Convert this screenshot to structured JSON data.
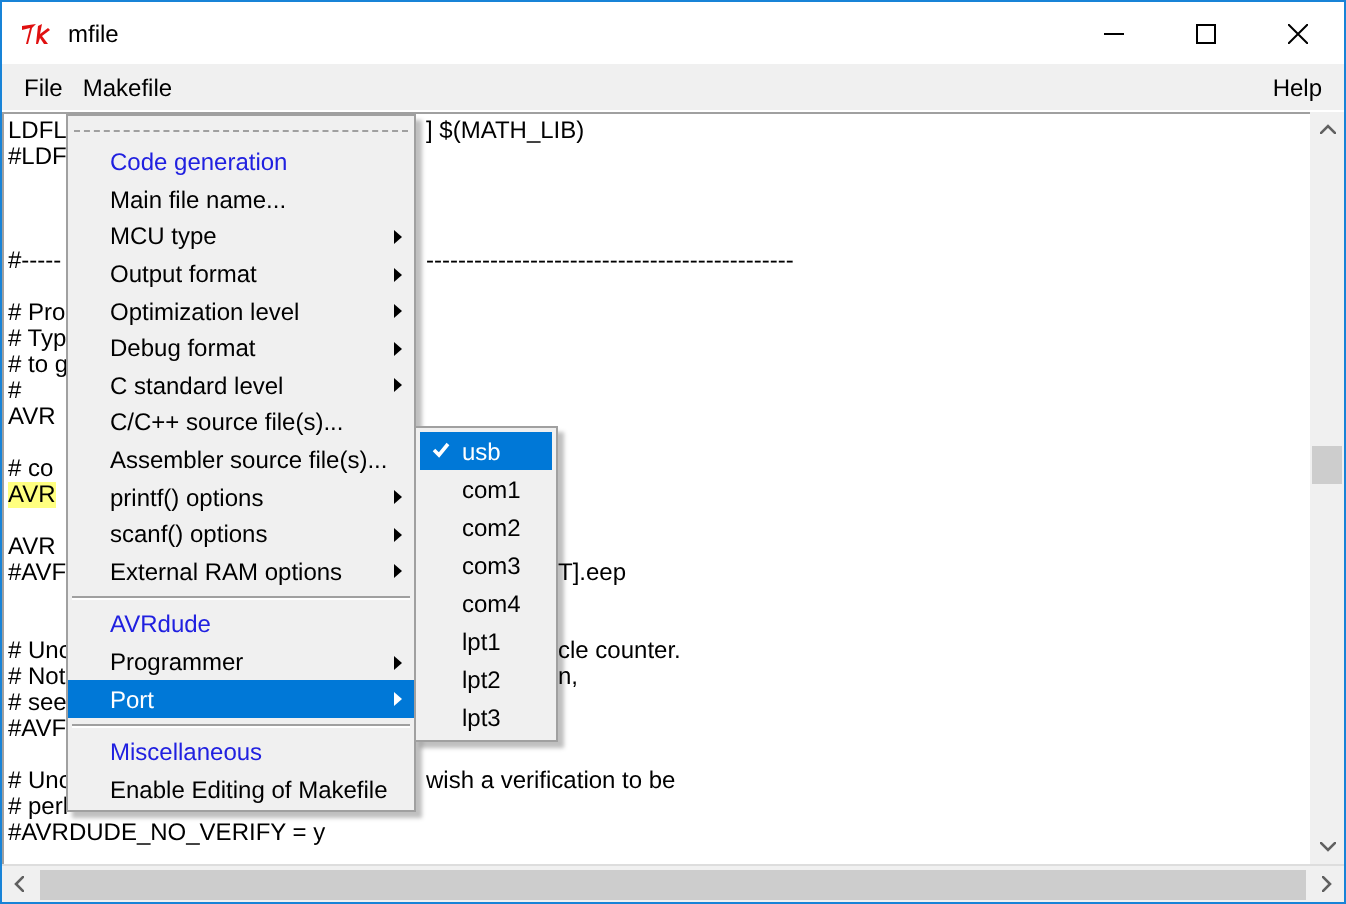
{
  "window": {
    "title": "mfile"
  },
  "menubar": {
    "items": [
      {
        "label": "File"
      },
      {
        "label": "Makefile"
      }
    ],
    "help": "Help"
  },
  "editor": {
    "lines": [
      {
        "kind": "text",
        "text": "LDFL",
        "tail": "] $(MATH_LIB)",
        "highlighted": false
      },
      {
        "kind": "text",
        "text": "#LDF",
        "highlighted": false
      },
      {
        "kind": "blank"
      },
      {
        "kind": "blank"
      },
      {
        "kind": "blank"
      },
      {
        "kind": "text",
        "text": "#-----",
        "tail": "----------------------------------------------",
        "highlighted": false
      },
      {
        "kind": "blank"
      },
      {
        "kind": "text",
        "text": "# Pro",
        "highlighted": false
      },
      {
        "kind": "text",
        "text": "# Typ",
        "highlighted": false
      },
      {
        "kind": "text",
        "text": "# to g",
        "highlighted": false
      },
      {
        "kind": "text",
        "text": "#",
        "highlighted": false
      },
      {
        "kind": "text",
        "text": "AVR",
        "highlighted": false
      },
      {
        "kind": "blank"
      },
      {
        "kind": "text",
        "text": "# co",
        "highlighted": false
      },
      {
        "kind": "text",
        "text": "AVR",
        "highlighted": true
      },
      {
        "kind": "blank"
      },
      {
        "kind": "text",
        "text": "AVR",
        "highlighted": false
      },
      {
        "kind": "text",
        "text": "#AVF",
        "tail": "T].eep",
        "highlighted": false
      },
      {
        "kind": "blank"
      },
      {
        "kind": "blank"
      },
      {
        "kind": "text",
        "text": "# Unc",
        "tail": "cle counter.",
        "highlighted": false
      },
      {
        "kind": "text",
        "text": "# Not",
        "tail": "n,",
        "highlighted": false
      },
      {
        "kind": "text",
        "text": "# see",
        "highlighted": false
      },
      {
        "kind": "text",
        "text": "#AVF",
        "highlighted": false
      },
      {
        "kind": "blank"
      },
      {
        "kind": "text",
        "text": "# Unc",
        "tail": "wish a verification to be",
        "highlighted": false
      },
      {
        "kind": "text",
        "text": "# perl",
        "highlighted": false
      },
      {
        "kind": "text",
        "text": "#AVRDUDE_NO_VERIFY = y",
        "highlighted": false
      }
    ]
  },
  "menu": {
    "items": [
      {
        "kind": "header",
        "label": "Code generation"
      },
      {
        "kind": "command",
        "label": "Main file name...",
        "selected": false
      },
      {
        "kind": "cascade",
        "label": "MCU type",
        "selected": false
      },
      {
        "kind": "cascade",
        "label": "Output format",
        "selected": false
      },
      {
        "kind": "cascade",
        "label": "Optimization level",
        "selected": false
      },
      {
        "kind": "cascade",
        "label": "Debug format",
        "selected": false
      },
      {
        "kind": "cascade",
        "label": "C standard level",
        "selected": false
      },
      {
        "kind": "command",
        "label": "C/C++ source file(s)...",
        "selected": false
      },
      {
        "kind": "command",
        "label": "Assembler source file(s)...",
        "selected": false
      },
      {
        "kind": "cascade",
        "label": "printf() options",
        "selected": false
      },
      {
        "kind": "cascade",
        "label": "scanf() options",
        "selected": false
      },
      {
        "kind": "cascade",
        "label": "External RAM options",
        "selected": false
      },
      {
        "kind": "separator"
      },
      {
        "kind": "header",
        "label": "AVRdude"
      },
      {
        "kind": "cascade",
        "label": "Programmer",
        "selected": false
      },
      {
        "kind": "cascade",
        "label": "Port",
        "selected": true
      },
      {
        "kind": "separator"
      },
      {
        "kind": "header",
        "label": "Miscellaneous"
      },
      {
        "kind": "command",
        "label": "Enable Editing of Makefile",
        "selected": false
      }
    ]
  },
  "port_submenu": {
    "items": [
      {
        "label": "usb",
        "checked": true,
        "selected": true
      },
      {
        "label": "com1",
        "checked": false,
        "selected": false
      },
      {
        "label": "com2",
        "checked": false,
        "selected": false
      },
      {
        "label": "com3",
        "checked": false,
        "selected": false
      },
      {
        "label": "com4",
        "checked": false,
        "selected": false
      },
      {
        "label": "lpt1",
        "checked": false,
        "selected": false
      },
      {
        "label": "lpt2",
        "checked": false,
        "selected": false
      },
      {
        "label": "lpt3",
        "checked": false,
        "selected": false
      }
    ]
  }
}
